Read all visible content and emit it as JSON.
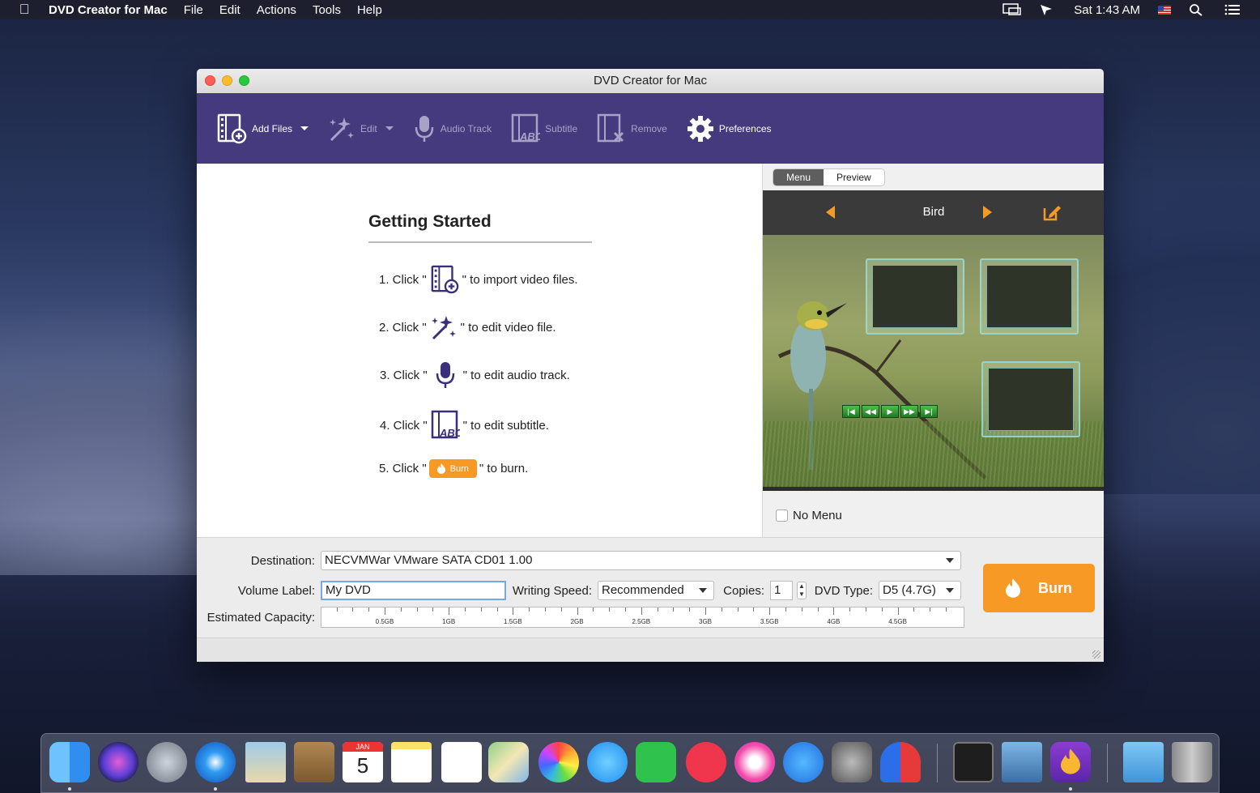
{
  "menubar": {
    "app_name": "DVD Creator for Mac",
    "items": [
      "File",
      "Edit",
      "Actions",
      "Tools",
      "Help"
    ],
    "clock": "Sat 1:43 AM",
    "icons": [
      "apple-icon",
      "display-mirroring-icon",
      "location-icon",
      "us-flag-icon",
      "spotlight-icon",
      "notification-center-icon"
    ]
  },
  "window": {
    "title": "DVD Creator for Mac"
  },
  "toolbar": {
    "add_files": "Add Files",
    "edit": "Edit",
    "audio_track": "Audio Track",
    "subtitle": "Subtitle",
    "remove": "Remove",
    "preferences": "Preferences"
  },
  "getting_started": {
    "title": "Getting Started",
    "steps": [
      {
        "prefix": "1. Click \"",
        "suffix": "\" to import video files.",
        "icon": "add-files-icon"
      },
      {
        "prefix": "2. Click \"",
        "suffix": "\" to edit video file.",
        "icon": "magic-wand-icon"
      },
      {
        "prefix": "3. Click \"",
        "suffix": "\" to edit audio track.",
        "icon": "microphone-icon"
      },
      {
        "prefix": "4. Click \"",
        "suffix": "\" to edit subtitle.",
        "icon": "subtitle-icon"
      },
      {
        "prefix": "5. Click \"",
        "suffix": "\" to burn.",
        "icon": "burn-icon"
      }
    ],
    "burn_label": "Burn"
  },
  "menu_panel": {
    "tabs": [
      {
        "label": "Menu",
        "selected": true
      },
      {
        "label": "Preview",
        "selected": false
      }
    ],
    "template_name": "Bird",
    "no_menu_label": "No Menu",
    "no_menu_checked": false
  },
  "settings": {
    "destination_label": "Destination:",
    "destination_value": "NECVMWar VMware SATA CD01 1.00",
    "volume_label_label": "Volume Label:",
    "volume_label_value": "My DVD",
    "writing_speed_label": "Writing Speed:",
    "writing_speed_value": "Recommended",
    "copies_label": "Copies:",
    "copies_value": "1",
    "dvd_type_label": "DVD Type:",
    "dvd_type_value": "D5 (4.7G)",
    "capacity_label": "Estimated Capacity:",
    "capacity_ticks": [
      "0.5GB",
      "1GB",
      "1.5GB",
      "2GB",
      "2.5GB",
      "3GB",
      "3.5GB",
      "4GB",
      "4.5GB"
    ],
    "capacity_used_fraction": 0
  },
  "burn_button": "Burn",
  "colors": {
    "toolbar_bg": "#453a7d",
    "accent_orange": "#f79a25"
  },
  "dock": {
    "apps": [
      "finder-icon",
      "siri-icon",
      "launchpad-icon",
      "safari-icon",
      "mail-icon",
      "contacts-icon",
      "calendar-icon",
      "notes-icon",
      "reminders-icon",
      "maps-icon",
      "photos-icon",
      "messages-icon",
      "facetime-icon",
      "news-icon",
      "itunes-icon",
      "app-store-icon",
      "system-preferences-icon",
      "magnet-icon",
      "terminal-icon",
      "preview-icon",
      "dvd-creator-icon",
      "downloads-folder-icon",
      "trash-icon"
    ],
    "calendar_month": "JAN",
    "calendar_day": "5"
  }
}
